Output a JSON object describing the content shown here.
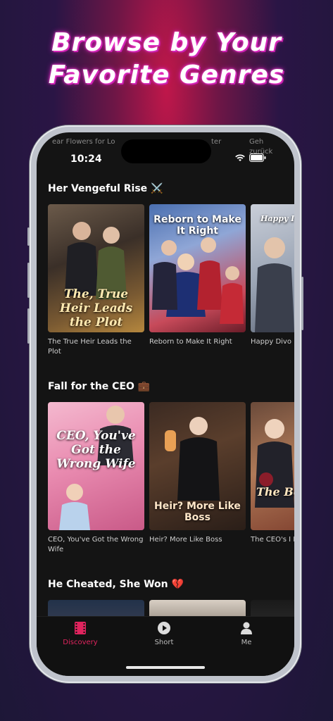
{
  "headline": {
    "line1": "Browse by Your",
    "line2": "Favorite Genres"
  },
  "status_bar": {
    "time": "10:24",
    "ghost_left": "ear Flowers for Lo",
    "ghost_mid": "ter",
    "ghost_right1": "Geh",
    "ghost_right2": "zurück"
  },
  "sections": [
    {
      "title": "Her Vengeful Rise ⚔️",
      "items": [
        {
          "caption": "The True Heir Leads the Plot",
          "poster_text": "The, True Heir Leads the Plot"
        },
        {
          "caption": "Reborn to Make It Right",
          "poster_text": "Reborn to Make It Right"
        },
        {
          "caption": "Happy Divo Big Shot",
          "poster_text": "Happy I'm No"
        }
      ]
    },
    {
      "title": "Fall for the CEO 💼",
      "items": [
        {
          "caption": "CEO, You've Got the Wrong Wife",
          "poster_text": "CEO, You've Got the Wrong Wife"
        },
        {
          "caption": "Heir? More Like Boss",
          "poster_text": "Heir? More Like Boss"
        },
        {
          "caption": "The CEO's I Returns",
          "poster_text": "The Belo Re"
        }
      ]
    },
    {
      "title": "He Cheated, She Won 💔",
      "items": []
    }
  ],
  "tabs": [
    {
      "label": "Discovery",
      "icon": "film-icon",
      "active": true
    },
    {
      "label": "Short",
      "icon": "play-icon",
      "active": false
    },
    {
      "label": "Me",
      "icon": "person-icon",
      "active": false
    }
  ],
  "colors": {
    "accent": "#e0245e",
    "inactive": "#9a9a9a"
  }
}
